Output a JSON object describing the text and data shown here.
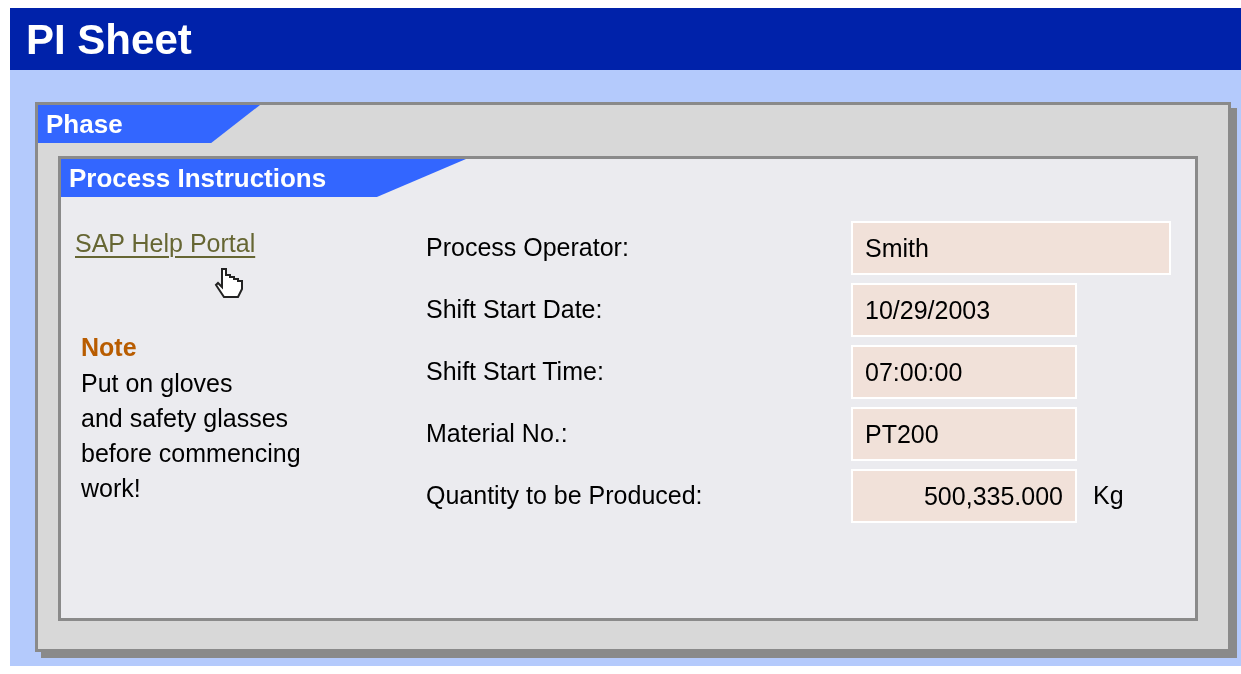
{
  "header": {
    "title": "PI Sheet"
  },
  "phase": {
    "title": "Phase"
  },
  "section": {
    "title": "Process Instructions"
  },
  "link": {
    "label": "SAP Help Portal"
  },
  "note": {
    "title": "Note",
    "text": "Put on gloves\nand safety glasses\nbefore commencing\nwork!"
  },
  "fields": [
    {
      "label": "Process Operator:",
      "value": "Smith",
      "kind": "wide"
    },
    {
      "label": "Shift Start Date:",
      "value": "10/29/2003",
      "kind": "normal"
    },
    {
      "label": "Shift Start Time:",
      "value": "07:00:00",
      "kind": "normal"
    },
    {
      "label": "Material No.:",
      "value": "PT200",
      "kind": "normal"
    },
    {
      "label": "Quantity to be Produced:",
      "value": "500,335.000",
      "kind": "number",
      "unit": "Kg"
    }
  ]
}
